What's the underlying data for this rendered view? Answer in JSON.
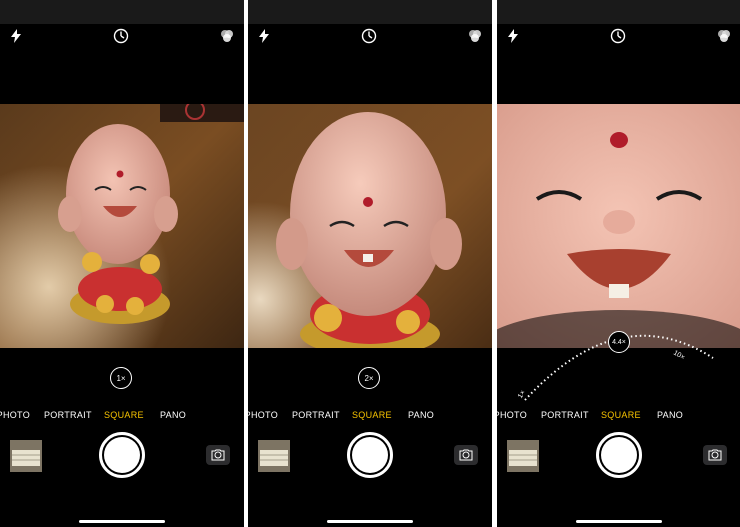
{
  "panels": [
    {
      "zoom_label": "1×",
      "modes": [
        "PHOTO",
        "PORTRAIT",
        "SQUARE",
        "PANO"
      ],
      "active_mode": "SQUARE"
    },
    {
      "zoom_label": "2×",
      "modes": [
        "PHOTO",
        "PORTRAIT",
        "SQUARE",
        "PANO"
      ],
      "active_mode": "SQUARE"
    },
    {
      "dial": {
        "min_label": "1×",
        "current_label": "4.4×",
        "max_label": "10×"
      },
      "modes": [
        "PHOTO",
        "PORTRAIT",
        "SQUARE",
        "PANO"
      ],
      "active_mode": "SQUARE"
    }
  ],
  "icons": {
    "flash": "flash-icon",
    "timer": "timer-icon",
    "live_photo": "live-photo-icon",
    "flip_camera": "flip-camera-icon"
  },
  "colors": {
    "active_mode": "#f7c300",
    "background": "#000000"
  }
}
